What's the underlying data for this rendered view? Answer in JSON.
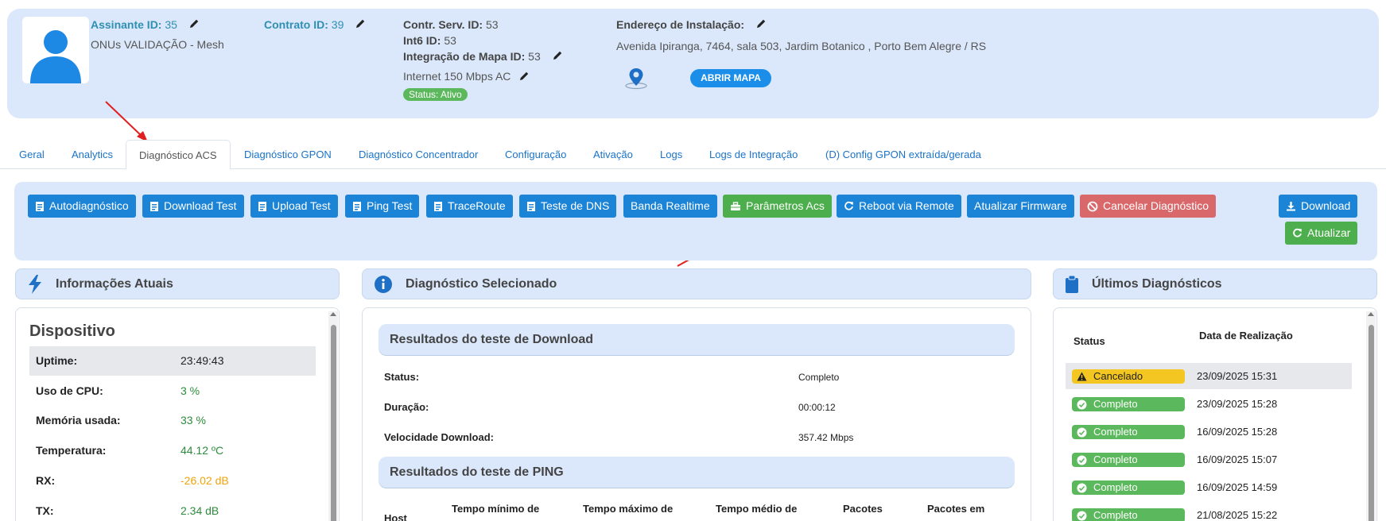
{
  "header": {
    "assinante_label": "Assinante ID:",
    "assinante_id": "35",
    "assinante_name": "ONUs VALIDAÇÃO - Mesh",
    "contrato_label": "Contrato ID:",
    "contrato_id": "39",
    "contr_serv_label": "Contr. Serv. ID:",
    "contr_serv_id": "53",
    "int6_label": "Int6 ID:",
    "int6_id": "53",
    "mapa_label": "Integração de Mapa ID:",
    "mapa_id": "53",
    "plan": "Internet 150 Mbps AC",
    "status": "Status: Ativo",
    "endereco_label": "Endereço de Instalação:",
    "endereco": "Avenida Ipiranga, 7464, sala 503, Jardim Botanico , Porto Bem Alegre / RS",
    "map_button": "ABRIR MAPA"
  },
  "tabs": [
    "Geral",
    "Analytics",
    "Diagnóstico ACS",
    "Diagnóstico GPON",
    "Diagnóstico Concentrador",
    "Configuração",
    "Ativação",
    "Logs",
    "Logs de Integração",
    "(D) Config GPON extraída/gerada"
  ],
  "toolbar": {
    "buttons": [
      "Autodiagnóstico",
      "Download Test",
      "Upload Test",
      "Ping Test",
      "TraceRoute",
      "Teste de DNS",
      "Banda Realtime",
      "Parâmetros Acs",
      "Reboot via Remote",
      "Atualizar Firmware",
      "Cancelar Diagnóstico"
    ],
    "download": "Download",
    "atualizar": "Atualizar"
  },
  "panels": {
    "info_title": "Informações Atuais",
    "selected_title": "Diagnóstico Selecionado",
    "last_title": "Últimos Diagnósticos"
  },
  "device": {
    "title": "Dispositivo",
    "rows": [
      {
        "key": "Uptime:",
        "value": "23:49:43",
        "color": "#222222"
      },
      {
        "key": "Uso de CPU:",
        "value": "3 %",
        "color": "#2e8b3d"
      },
      {
        "key": "Memória usada:",
        "value": "33 %",
        "color": "#2e8b3d"
      },
      {
        "key": "Temperatura:",
        "value": "44.12 ºC",
        "color": "#2e8b3d"
      },
      {
        "key": "RX:",
        "value": "-26.02 dB",
        "color": "#f0a30a"
      },
      {
        "key": "TX:",
        "value": "2.34 dB",
        "color": "#2e8b3d"
      }
    ]
  },
  "download_results": {
    "title": "Resultados do teste de Download",
    "rows": [
      {
        "key": "Status:",
        "value": "Completo"
      },
      {
        "key": "Duração:",
        "value": "00:00:12"
      },
      {
        "key": "Velocidade Download:",
        "value": "357.42 Mbps"
      }
    ]
  },
  "ping_results": {
    "title": "Resultados do teste de PING",
    "columns": [
      "Host",
      "Tempo mínimo de",
      "Tempo máximo de",
      "Tempo médio de",
      "Pacotes",
      "Pacotes em"
    ]
  },
  "last_diagnostics": {
    "col_status": "Status",
    "col_date": "Data de Realização",
    "rows": [
      {
        "status": "Cancelado",
        "type": "warn",
        "date": "23/09/2025 15:31"
      },
      {
        "status": "Completo",
        "type": "ok",
        "date": "23/09/2025 15:28"
      },
      {
        "status": "Completo",
        "type": "ok",
        "date": "16/09/2025 15:28"
      },
      {
        "status": "Completo",
        "type": "ok",
        "date": "16/09/2025 15:07"
      },
      {
        "status": "Completo",
        "type": "ok",
        "date": "16/09/2025 14:59"
      },
      {
        "status": "Completo",
        "type": "ok",
        "date": "21/08/2025 15:22"
      }
    ]
  }
}
